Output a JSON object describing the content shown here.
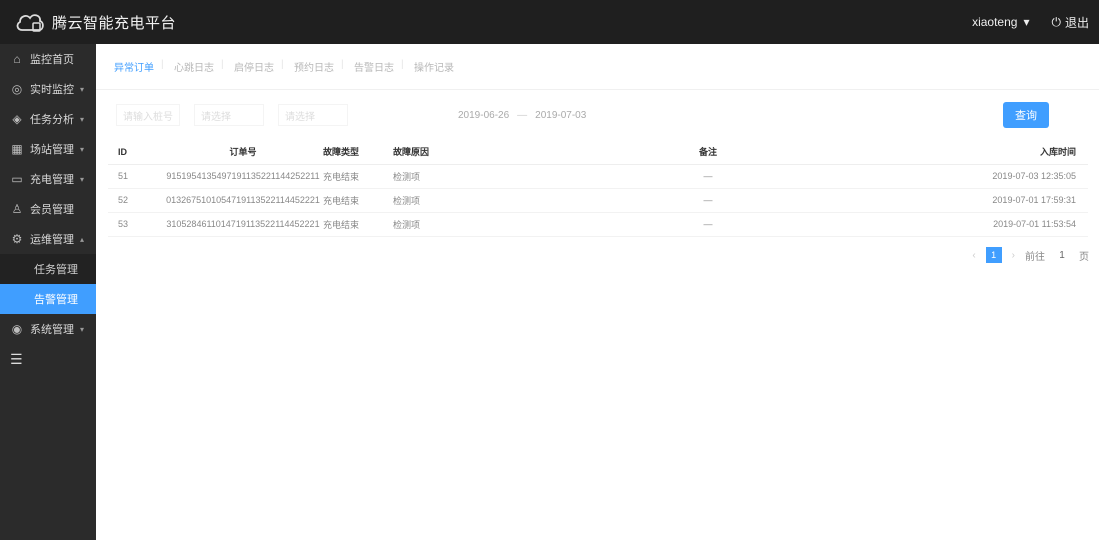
{
  "app": {
    "title": "腾云智能充电平台"
  },
  "header": {
    "user": "xiaoteng",
    "logout": "退出"
  },
  "sidebar": {
    "items": [
      {
        "label": "监控首页",
        "icon": "home-icon"
      },
      {
        "label": "实时监控",
        "icon": "monitor-icon"
      },
      {
        "label": "任务分析",
        "icon": "analysis-icon"
      },
      {
        "label": "场站管理",
        "icon": "grid-icon"
      },
      {
        "label": "充电管理",
        "icon": "charge-icon"
      },
      {
        "label": "会员管理",
        "icon": "user-icon"
      },
      {
        "label": "运维管理",
        "icon": "ops-icon"
      }
    ],
    "subitems": [
      {
        "label": "任务管理"
      },
      {
        "label": "告警管理"
      }
    ],
    "extra": {
      "label": "系统管理",
      "icon": "settings-icon"
    }
  },
  "tabs": [
    "异常订单",
    "心跳日志",
    "启停日志",
    "预约日志",
    "告警日志",
    "操作记录"
  ],
  "filters": {
    "input1": "请输入桩号",
    "input2": "请选择",
    "input3": "请选择",
    "date_start": "2019-06-26",
    "date_end": "2019-07-03",
    "query": "查询"
  },
  "table": {
    "headers": {
      "id": "ID",
      "order": "订单号",
      "type": "故障类型",
      "reason": "故障原因",
      "note": "备注",
      "time": "入库时间"
    },
    "rows": [
      {
        "id": "51",
        "order": "9151954135497191135221144252211",
        "type": "充电结束",
        "reason": "检测项",
        "note": "—",
        "time": "2019-07-03 12:35:05"
      },
      {
        "id": "52",
        "order": "0132675101054719113522114452221",
        "type": "充电结束",
        "reason": "检测项",
        "note": "—",
        "time": "2019-07-01 17:59:31"
      },
      {
        "id": "53",
        "order": "3105284611014719113522114452221",
        "type": "充电结束",
        "reason": "检测项",
        "note": "—",
        "time": "2019-07-01 11:53:54"
      }
    ]
  },
  "pager": {
    "page": "1",
    "goto": "前往",
    "page_value": "1",
    "suffix": "页"
  }
}
